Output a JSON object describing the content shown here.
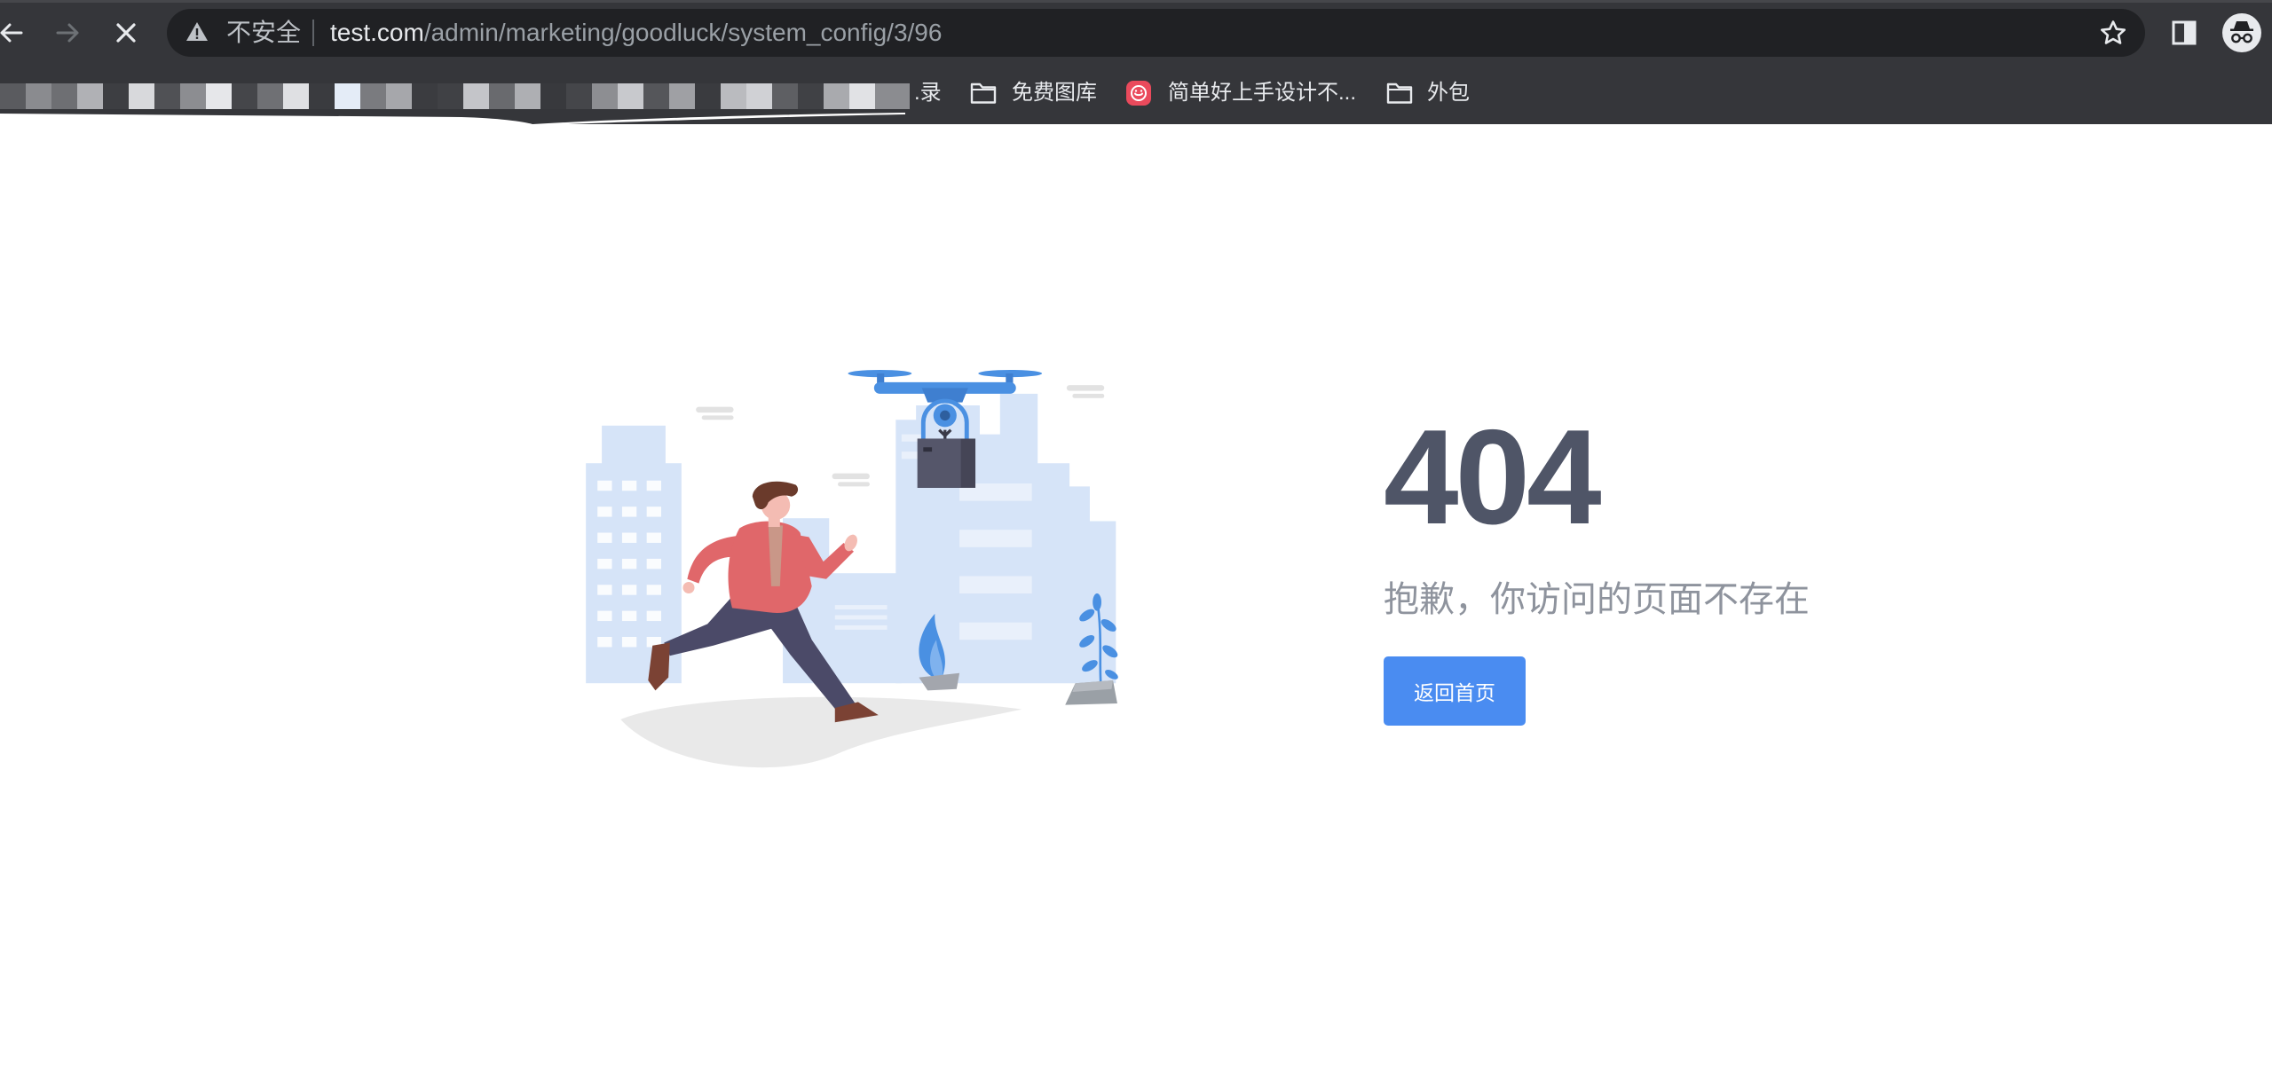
{
  "window": {
    "security_label": "不安全",
    "url_host": "test.com",
    "url_path": "/admin/marketing/goodluck/system_config/3/96",
    "nav_icons": [
      "back-icon",
      "forward-icon",
      "stop-icon"
    ],
    "toolbar_icons": [
      "star-icon",
      "sidebar-icon",
      "incognito-avatar"
    ]
  },
  "bookmarks": [
    {
      "label": ".录"
    },
    {
      "label": "免费图库",
      "icon": "folder-icon"
    },
    {
      "label": "简单好上手设计不...",
      "icon": "app-icon"
    },
    {
      "label": "外包",
      "icon": "folder-icon"
    }
  ],
  "error_page": {
    "code": "404",
    "message": "抱歉，你访问的页面不存在",
    "home_button_label": "返回首页",
    "illustration": "man-running-under-drone-city-illustration"
  },
  "colors": {
    "chrome_bg": "#35363a",
    "omnibox_bg": "#202124",
    "code_text": "#4f5567",
    "message_text": "#8e939d",
    "button_bg": "#4a8cf1",
    "illustration_accent": "#4a90e2"
  }
}
